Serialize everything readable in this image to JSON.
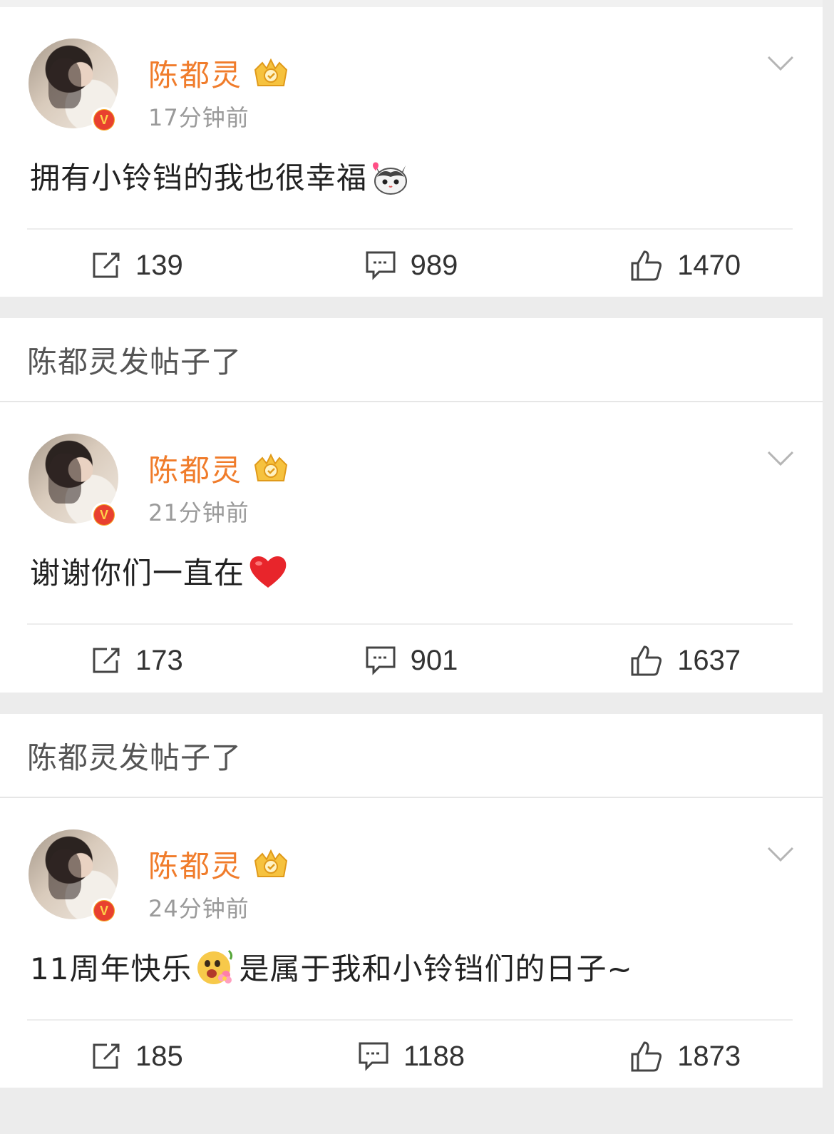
{
  "posts": [
    {
      "author": "陈都灵",
      "time": "17分钟前",
      "text": "拥有小铃铛的我也很幸福",
      "emoji_icon": "cat-emoji",
      "reposts": "139",
      "comments": "989",
      "likes": "1470"
    },
    {
      "author": "陈都灵",
      "time": "21分钟前",
      "text": "谢谢你们一直在",
      "emoji_icon": "heart-emoji",
      "reposts": "173",
      "comments": "901",
      "likes": "1637"
    },
    {
      "author": "陈都灵",
      "time": "24分钟前",
      "text_before": "11周年快乐",
      "text_after": "是属于我和小铃铛们的日子~",
      "emoji_icon": "flower-face-emoji",
      "reposts": "185",
      "comments": "1188",
      "likes": "1873"
    }
  ],
  "repost_headers": [
    "陈都灵发帖子了",
    "陈都灵发帖子了"
  ],
  "colors": {
    "name": "#f07c2b",
    "badge": "#e8402f",
    "background": "#ececec"
  }
}
